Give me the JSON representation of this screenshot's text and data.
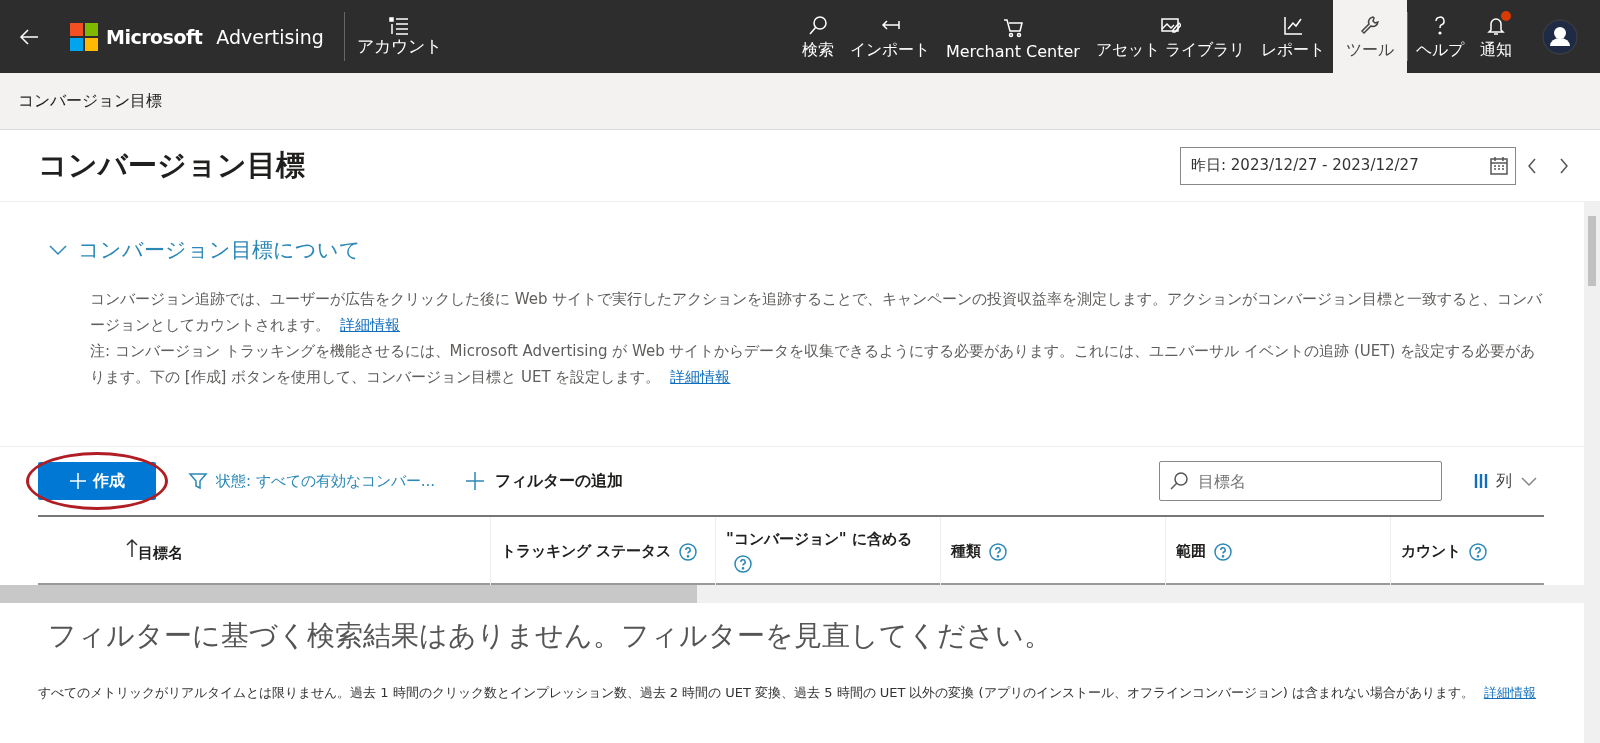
{
  "top_bar": {
    "brand": {
      "company": "Microsoft",
      "product": "Advertising"
    },
    "account": {
      "label": "アカウント"
    },
    "nav": [
      {
        "label": "検索",
        "selected": false
      },
      {
        "label": "インポート",
        "selected": false
      },
      {
        "label": "Merchant Center",
        "selected": false
      },
      {
        "label": "アセット ライブラリ",
        "selected": false
      },
      {
        "label": "レポート",
        "selected": false
      },
      {
        "label": "ツール",
        "selected": true
      },
      {
        "label": "ヘルプ",
        "selected": false
      },
      {
        "label": "通知",
        "selected": false,
        "alert": true
      }
    ]
  },
  "breadcrumb": "コンバージョン目標",
  "page_title": "コンバージョン目標",
  "date_range": {
    "value": "昨日: 2023/12/27 - 2023/12/27"
  },
  "about": {
    "heading": "コンバージョン目標について",
    "expanded": true,
    "paragraphs": [
      {
        "text": "コンバージョン追跡では、ユーザーが広告をクリックした後に Web サイトで実行したアクションを追跡することで、キャンペーンの投資収益率を測定します。アクションがコンバージョン目標と一致すると、コンバージョンとしてカウントされます。",
        "link": "詳細情報"
      },
      {
        "text": "注: コンバージョン トラッキングを機能させるには、Microsoft Advertising が Web サイトからデータを収集できるようにする必要があります。これには、ユニバーサル イベントの追跡 (UET) を設定する必要があります。下の [作成] ボタンを使用して、コンバージョン目標と UET を設定します。",
        "link": "詳細情報"
      }
    ]
  },
  "toolbar": {
    "create_button": "作成",
    "create_highlighted": true,
    "status_filter": "状態: すべての有効なコンバー...",
    "add_filter": "フィルターの追加",
    "search": {
      "placeholder": "目標名"
    },
    "columns_button": "列"
  },
  "table": {
    "columns": [
      {
        "label": "目標名",
        "sorted": true,
        "help": false
      },
      {
        "label": "トラッキング ステータス",
        "sorted": false,
        "help": true
      },
      {
        "label": "\"コンバージョン\" に含める",
        "sorted": false,
        "help": true
      },
      {
        "label": "種類",
        "sorted": false,
        "help": true
      },
      {
        "label": "範囲",
        "sorted": false,
        "help": true
      },
      {
        "label": "カウント",
        "sorted": false,
        "help": true
      }
    ],
    "empty_message": "フィルターに基づく検索結果はありません。フィルターを見直してください。"
  },
  "footer_note": {
    "text": "すべてのメトリックがリアルタイムとは限りません。過去 1 時間のクリック数とインプレッション数、過去 2 時間の UET 変換、過去 5 時間の UET 以外の変換 (アプリのインストール、オフラインコンバージョン) は含まれない場合があります。",
    "link": "詳細情報"
  }
}
